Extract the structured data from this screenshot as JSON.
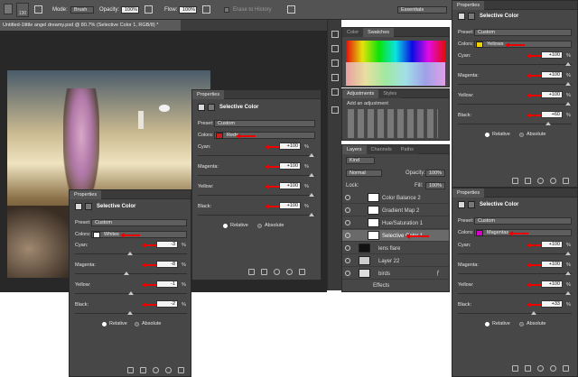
{
  "options_bar": {
    "brush_size": "130",
    "mode_label": "Mode:",
    "mode_value": "Brush",
    "opacity_label": "Opacity:",
    "opacity_value": "100%",
    "flow_label": "Flow:",
    "flow_value": "100%",
    "erase_history": "Erase to History",
    "workspace": "Essentials"
  },
  "document": {
    "tab_title": "Untitled-1little angel dreamy.psd @ 80.7% (Selective Color 1, RGB/8) *"
  },
  "swatches": {
    "tabs": [
      "Color",
      "Swatches"
    ]
  },
  "adjustments": {
    "tabs": [
      "Adjustments",
      "Styles"
    ],
    "heading": "Add an adjustment"
  },
  "layers": {
    "tabs": [
      "Layers",
      "Channels",
      "Paths"
    ],
    "kind": "Kind",
    "blend": "Normal",
    "opacity_label": "Opacity:",
    "opacity_value": "100%",
    "lock_label": "Lock:",
    "fill_label": "Fill:",
    "fill_value": "100%",
    "items": [
      {
        "name": "Color Balance 2"
      },
      {
        "name": "Gradient Map 2"
      },
      {
        "name": "Hue/Saturation 1"
      },
      {
        "name": "Selective Color 1"
      },
      {
        "name": "lens flare"
      },
      {
        "name": "Layer 22"
      },
      {
        "name": "birds"
      },
      {
        "name": "Effects"
      }
    ]
  },
  "panels": {
    "reds": {
      "tab": "Properties",
      "title": "Selective Color",
      "preset_label": "Preset:",
      "preset": "Custom",
      "colors_label": "Colors:",
      "color_name": "Reds",
      "swatch": "#c81e1e",
      "rows": [
        {
          "label": "Cyan:",
          "value": "+100"
        },
        {
          "label": "Magenta:",
          "value": "+100"
        },
        {
          "label": "Yellow:",
          "value": "+100"
        },
        {
          "label": "Black:",
          "value": "+100"
        }
      ],
      "relative": "Relative",
      "absolute": "Absolute"
    },
    "whites": {
      "tab": "Properties",
      "title": "Selective Color",
      "preset_label": "Preset:",
      "preset": "Custom",
      "colors_label": "Colors:",
      "color_name": "Whites",
      "swatch": "#ffffff",
      "rows": [
        {
          "label": "Cyan:",
          "value": "-3"
        },
        {
          "label": "Magenta:",
          "value": "-8"
        },
        {
          "label": "Yellow:",
          "value": "-1"
        },
        {
          "label": "Black:",
          "value": "-2"
        }
      ],
      "relative": "Relative",
      "absolute": "Absolute"
    },
    "yellows": {
      "tab": "Properties",
      "title": "Selective Color",
      "preset_label": "Preset:",
      "preset": "Custom",
      "colors_label": "Colors:",
      "color_name": "Yellows",
      "swatch": "#f0d200",
      "rows": [
        {
          "label": "Cyan:",
          "value": "+100"
        },
        {
          "label": "Magenta:",
          "value": "+100"
        },
        {
          "label": "Yellow:",
          "value": "+100"
        },
        {
          "label": "Black:",
          "value": "+60"
        }
      ],
      "relative": "Relative",
      "absolute": "Absolute"
    },
    "magentas": {
      "tab": "Properties",
      "title": "Selective Color",
      "preset_label": "Preset:",
      "preset": "Custom",
      "colors_label": "Colors:",
      "color_name": "Magentas",
      "swatch": "#d400c8",
      "rows": [
        {
          "label": "Cyan:",
          "value": "+100"
        },
        {
          "label": "Magenta:",
          "value": "+100"
        },
        {
          "label": "Yellow:",
          "value": "+100"
        },
        {
          "label": "Black:",
          "value": "+33"
        }
      ],
      "relative": "Relative",
      "absolute": "Absolute"
    }
  },
  "pct_sign": "%"
}
